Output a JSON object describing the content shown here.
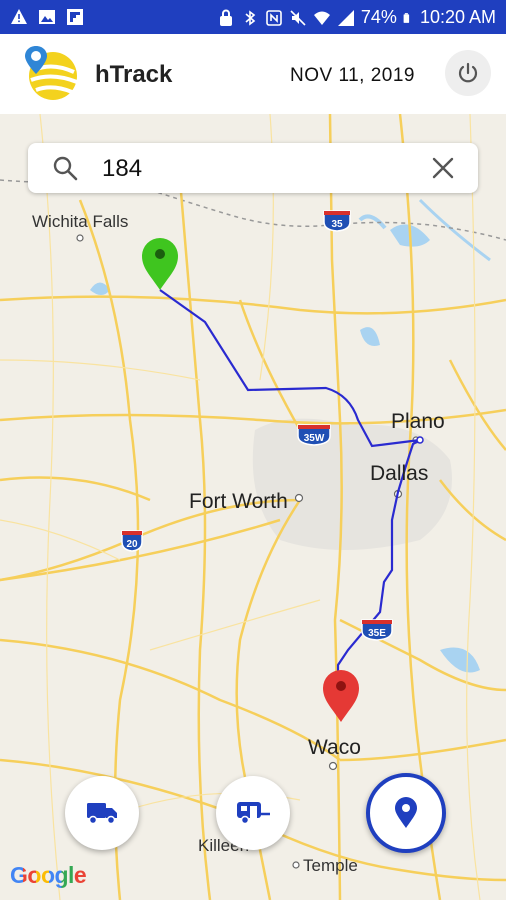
{
  "status_bar": {
    "battery": "74%",
    "time": "10:20 AM"
  },
  "app_bar": {
    "title": "hTrack",
    "date": "NOV 11, 2019"
  },
  "search": {
    "value": "184"
  },
  "map": {
    "labels": {
      "wichita_falls": "Wichita Falls",
      "plano": "Plano",
      "dallas": "Dallas",
      "fort_worth": "Fort Worth",
      "waco": "Waco",
      "killeen": "Killeen",
      "temple": "Temple"
    },
    "shields": {
      "i35": "35",
      "i35w": "35W",
      "i20": "20",
      "i35e": "35E"
    },
    "attribution": "Google"
  },
  "colors": {
    "status_bar": "#1f3fbf",
    "route": "#2a2ad0",
    "start_pin": "#3fc51f",
    "end_pin": "#e53935",
    "accent": "#1f3fbf"
  },
  "fab_icons": [
    "truck-icon",
    "trailer-icon",
    "location-pin-icon"
  ]
}
